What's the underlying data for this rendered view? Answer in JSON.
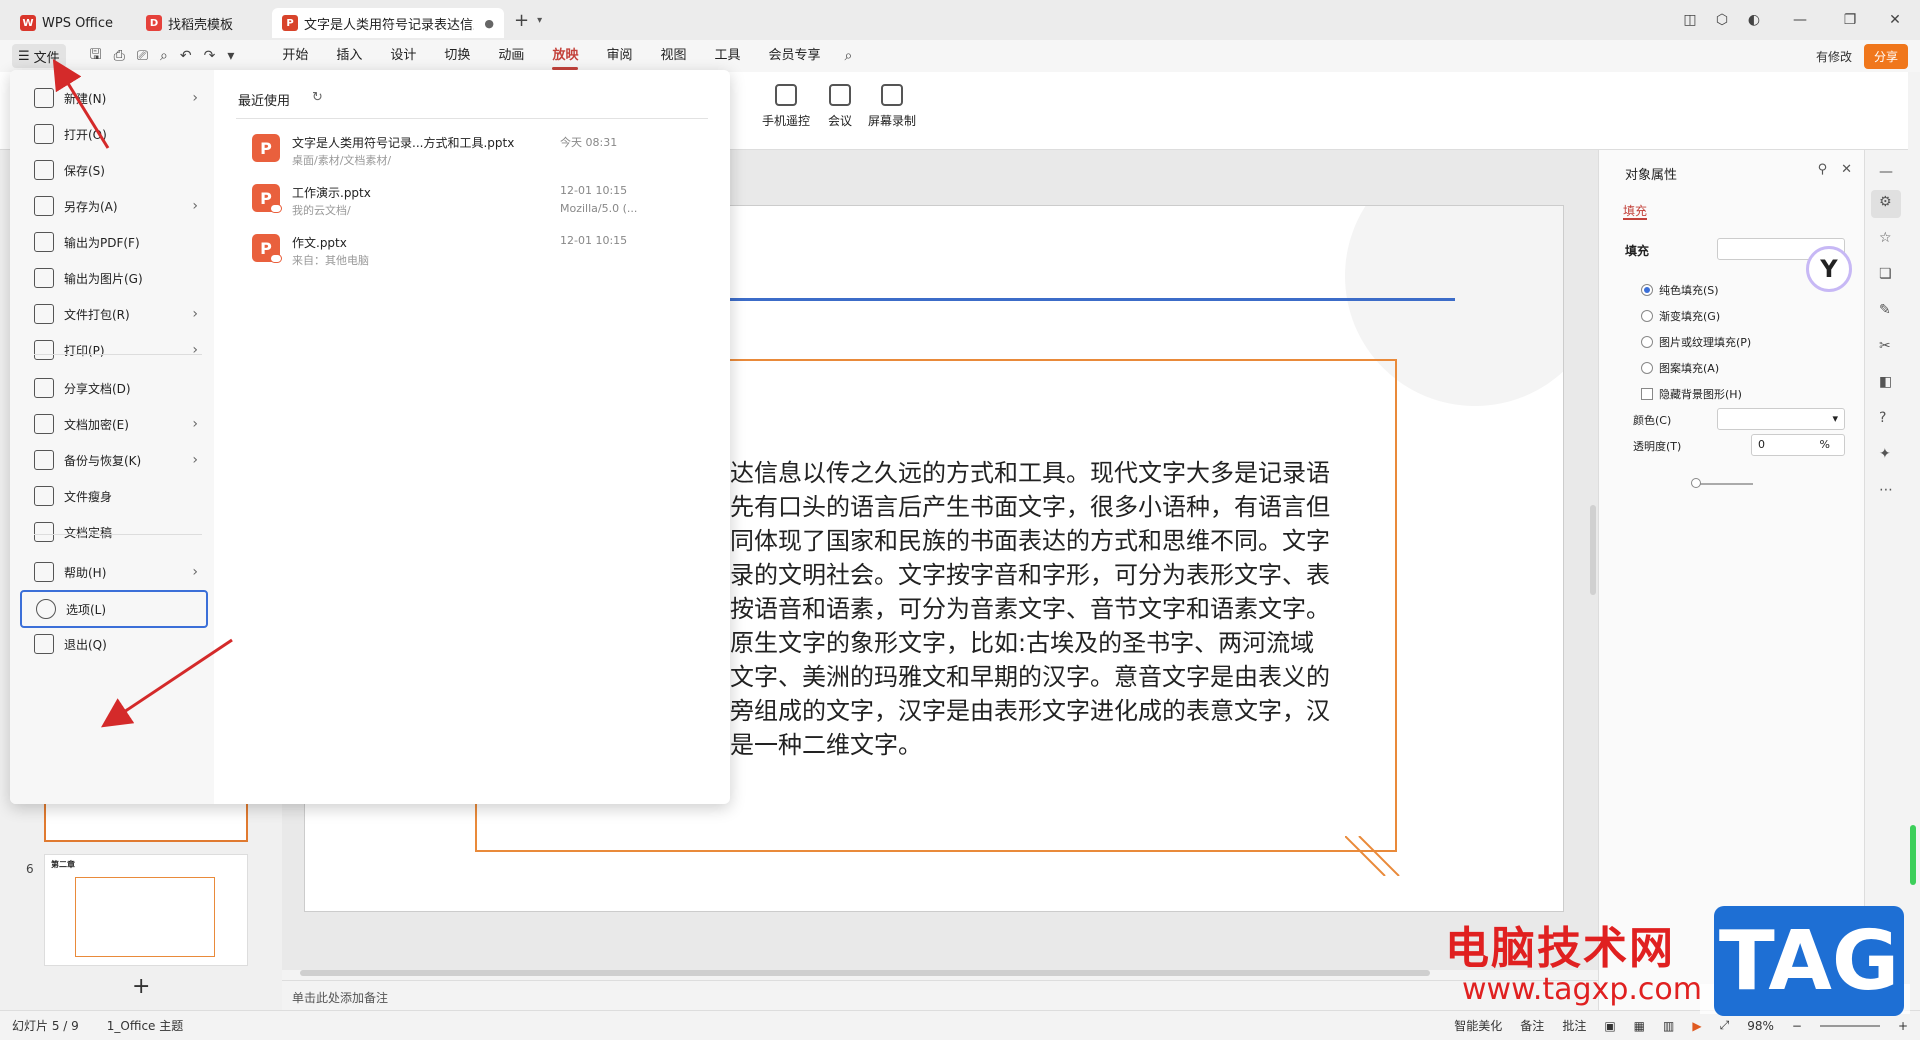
{
  "tabs": [
    {
      "label": "WPS Office",
      "icon": "W"
    },
    {
      "label": "找稻壳模板",
      "icon": "D"
    },
    {
      "label": "文字是人类用符号记录表达信息以",
      "icon": "P"
    }
  ],
  "menubar": {
    "file_label": "文件",
    "menus": [
      "开始",
      "插入",
      "设计",
      "切换",
      "动画",
      "放映",
      "审阅",
      "视图",
      "工具",
      "会员专享"
    ],
    "active_menu": "放映",
    "modified_label": "有修改",
    "share_label": "分享"
  },
  "ribbon": {
    "buttons": [
      "手机遥控",
      "会议",
      "屏幕录制"
    ]
  },
  "file_menu": {
    "items": [
      {
        "label": "新建(N)",
        "arrow": true
      },
      {
        "label": "打开(O)",
        "arrow": false
      },
      {
        "label": "保存(S)",
        "arrow": false
      },
      {
        "label": "另存为(A)",
        "arrow": true
      },
      {
        "label": "输出为PDF(F)",
        "arrow": false
      },
      {
        "label": "输出为图片(G)",
        "arrow": false
      },
      {
        "label": "文件打包(R)",
        "arrow": true
      },
      {
        "label": "打印(P)",
        "arrow": true
      },
      {
        "label": "分享文档(D)",
        "arrow": false
      },
      {
        "label": "文档加密(E)",
        "arrow": true
      },
      {
        "label": "备份与恢复(K)",
        "arrow": true
      },
      {
        "label": "文件瘦身",
        "arrow": false
      },
      {
        "label": "文档定稿",
        "arrow": false
      },
      {
        "label": "帮助(H)",
        "arrow": true
      },
      {
        "label": "选项(L)",
        "arrow": false
      },
      {
        "label": "退出(Q)",
        "arrow": false
      }
    ],
    "selected_item": "选项(L)",
    "recent_title": "最近使用",
    "recent_files": [
      {
        "name": "文字是人类用符号记录...方式和工具.pptx",
        "path": "桌面/素材/文档素材/",
        "time": "今天  08:31",
        "source": ""
      },
      {
        "name": "工作演示.pptx",
        "path": "我的云文档/",
        "time": "12-01  10:15",
        "source": "Mozilla/5.0 (..."
      },
      {
        "name": "作文.pptx",
        "path": "来自：其他电脑",
        "time": "12-01  10:15",
        "source": ""
      }
    ]
  },
  "slide": {
    "lines": [
      "达信息以传之久远的方式和工具。现代文字大多是记录语",
      "先有口头的语言后产生书面文字，很多小语种，有语言但",
      "同体现了国家和民族的书面表达的方式和思维不同。文字",
      "录的文明社会。文字按字音和字形，可分为表形文字、表",
      "按语音和语素，可分为音素文字、音节文字和语素文字。",
      "原生文字的象形文字，比如:古埃及的圣书字、两河流域",
      "文字、美洲的玛雅文和早期的汉字。意音文字是由表义的",
      "旁组成的文字，汉字是由表形文字进化成的表意文字，汉",
      "是一种二维文字。"
    ]
  },
  "thumbnails": {
    "slide6_number": "6",
    "slide6_title": "第二章"
  },
  "notes_placeholder": "单击此处添加备注",
  "right_panel": {
    "title": "对象属性",
    "tab": "填充",
    "fill_section": "填充",
    "options": [
      {
        "label": "纯色填充(S)",
        "checked": true
      },
      {
        "label": "渐变填充(G)",
        "checked": false
      },
      {
        "label": "图片或纹理填充(P)",
        "checked": false
      },
      {
        "label": "图案填充(A)",
        "checked": false
      }
    ],
    "hide_bg_label": "隐藏背景图形(H)",
    "color_label": "颜色(C)",
    "transparency_label": "透明度(T)",
    "transparency_value": "0",
    "transparency_unit": "%"
  },
  "status": {
    "slide_info": "幻灯片 5 / 9",
    "theme": "1_Office 主题",
    "beautify": "智能美化",
    "notes": "备注",
    "comments": "批注",
    "zoom": "98%"
  },
  "watermark": {
    "cn_text": "电脑技术网",
    "url": "www.tagxp.com",
    "tag": "TAG"
  },
  "colors": {
    "accent": "#c3423b",
    "share": "#f0771c",
    "slide_frame": "#e98a3a",
    "slide_bar": "#3c6cc8",
    "arrow": "#d42a2a"
  }
}
